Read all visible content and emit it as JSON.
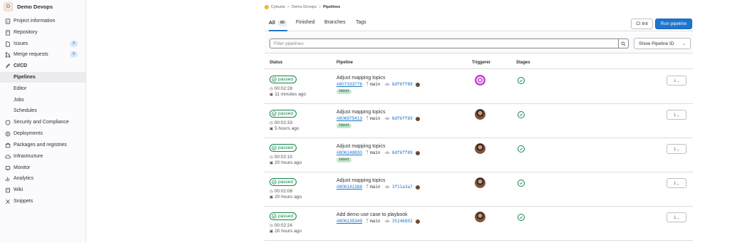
{
  "project": {
    "avatar_letter": "D",
    "name": "Demo Devops"
  },
  "sidebar": {
    "items": [
      {
        "label": "Project information",
        "icon": "info-icon"
      },
      {
        "label": "Repository",
        "icon": "book-icon"
      },
      {
        "label": "Issues",
        "icon": "issues-icon",
        "badge": "0"
      },
      {
        "label": "Merge requests",
        "icon": "merge-request-icon",
        "badge": "0"
      },
      {
        "label": "CI/CD",
        "icon": "rocket-icon"
      },
      {
        "label": "Pipelines"
      },
      {
        "label": "Editor"
      },
      {
        "label": "Jobs"
      },
      {
        "label": "Schedules"
      },
      {
        "label": "Security and Compliance",
        "icon": "shield-icon"
      },
      {
        "label": "Deployments",
        "icon": "deployments-icon"
      },
      {
        "label": "Packages and registries",
        "icon": "package-icon"
      },
      {
        "label": "Infrastructure",
        "icon": "cloud-icon"
      },
      {
        "label": "Monitor",
        "icon": "monitor-icon"
      },
      {
        "label": "Analytics",
        "icon": "chart-icon"
      },
      {
        "label": "Wiki",
        "icon": "wiki-icon"
      },
      {
        "label": "Snippets",
        "icon": "snippet-icon"
      }
    ]
  },
  "breadcrumb": {
    "root": "Cybusio",
    "project": "Demo Devops",
    "current": "Pipelines",
    "sep": ">"
  },
  "tabs": [
    {
      "label": "All",
      "badge": "88"
    },
    {
      "label": "Finished"
    },
    {
      "label": "Branches"
    },
    {
      "label": "Tags"
    }
  ],
  "actions": {
    "ci_lint": "CI lint",
    "run_pipeline": "Run pipeline"
  },
  "filter": {
    "placeholder": "Filter pipelines",
    "select_value": "Show Pipeline ID"
  },
  "table": {
    "headers": {
      "status": "Status",
      "pipeline": "Pipeline",
      "triggerer": "Triggerer",
      "stages": "Stages"
    },
    "rows": [
      {
        "status": "passed",
        "duration": "00:02:28",
        "ago": "11 minutes ago",
        "title": "Adjust mapping topics",
        "id": "#807333776",
        "branch": "main",
        "sha": "8df6ff89",
        "tag": "latest"
      },
      {
        "status": "passed",
        "duration": "00:02:33",
        "ago": "5 hours ago",
        "title": "Adjust mapping topics",
        "id": "#806975413",
        "branch": "main",
        "sha": "8df6ff89",
        "tag": "latest"
      },
      {
        "status": "passed",
        "duration": "00:02:10",
        "ago": "20 hours ago",
        "title": "Adjust mapping topics",
        "id": "#806148830",
        "branch": "main",
        "sha": "8df6ff89",
        "tag": "latest"
      },
      {
        "status": "passed",
        "duration": "00:02:08",
        "ago": "20 hours ago",
        "title": "Adjust mapping topics",
        "id": "#806141388",
        "branch": "main",
        "sha": "3f11a3a7"
      },
      {
        "status": "passed",
        "duration": "00:02:24",
        "ago": "20 hours ago",
        "title": "Add demo use case to playbook",
        "id": "#806135349",
        "branch": "main",
        "sha": "35246892"
      }
    ]
  },
  "colors": {
    "accent": "#1f75cb",
    "success": "#108548",
    "sidebar_bg": "#fbfafd"
  }
}
